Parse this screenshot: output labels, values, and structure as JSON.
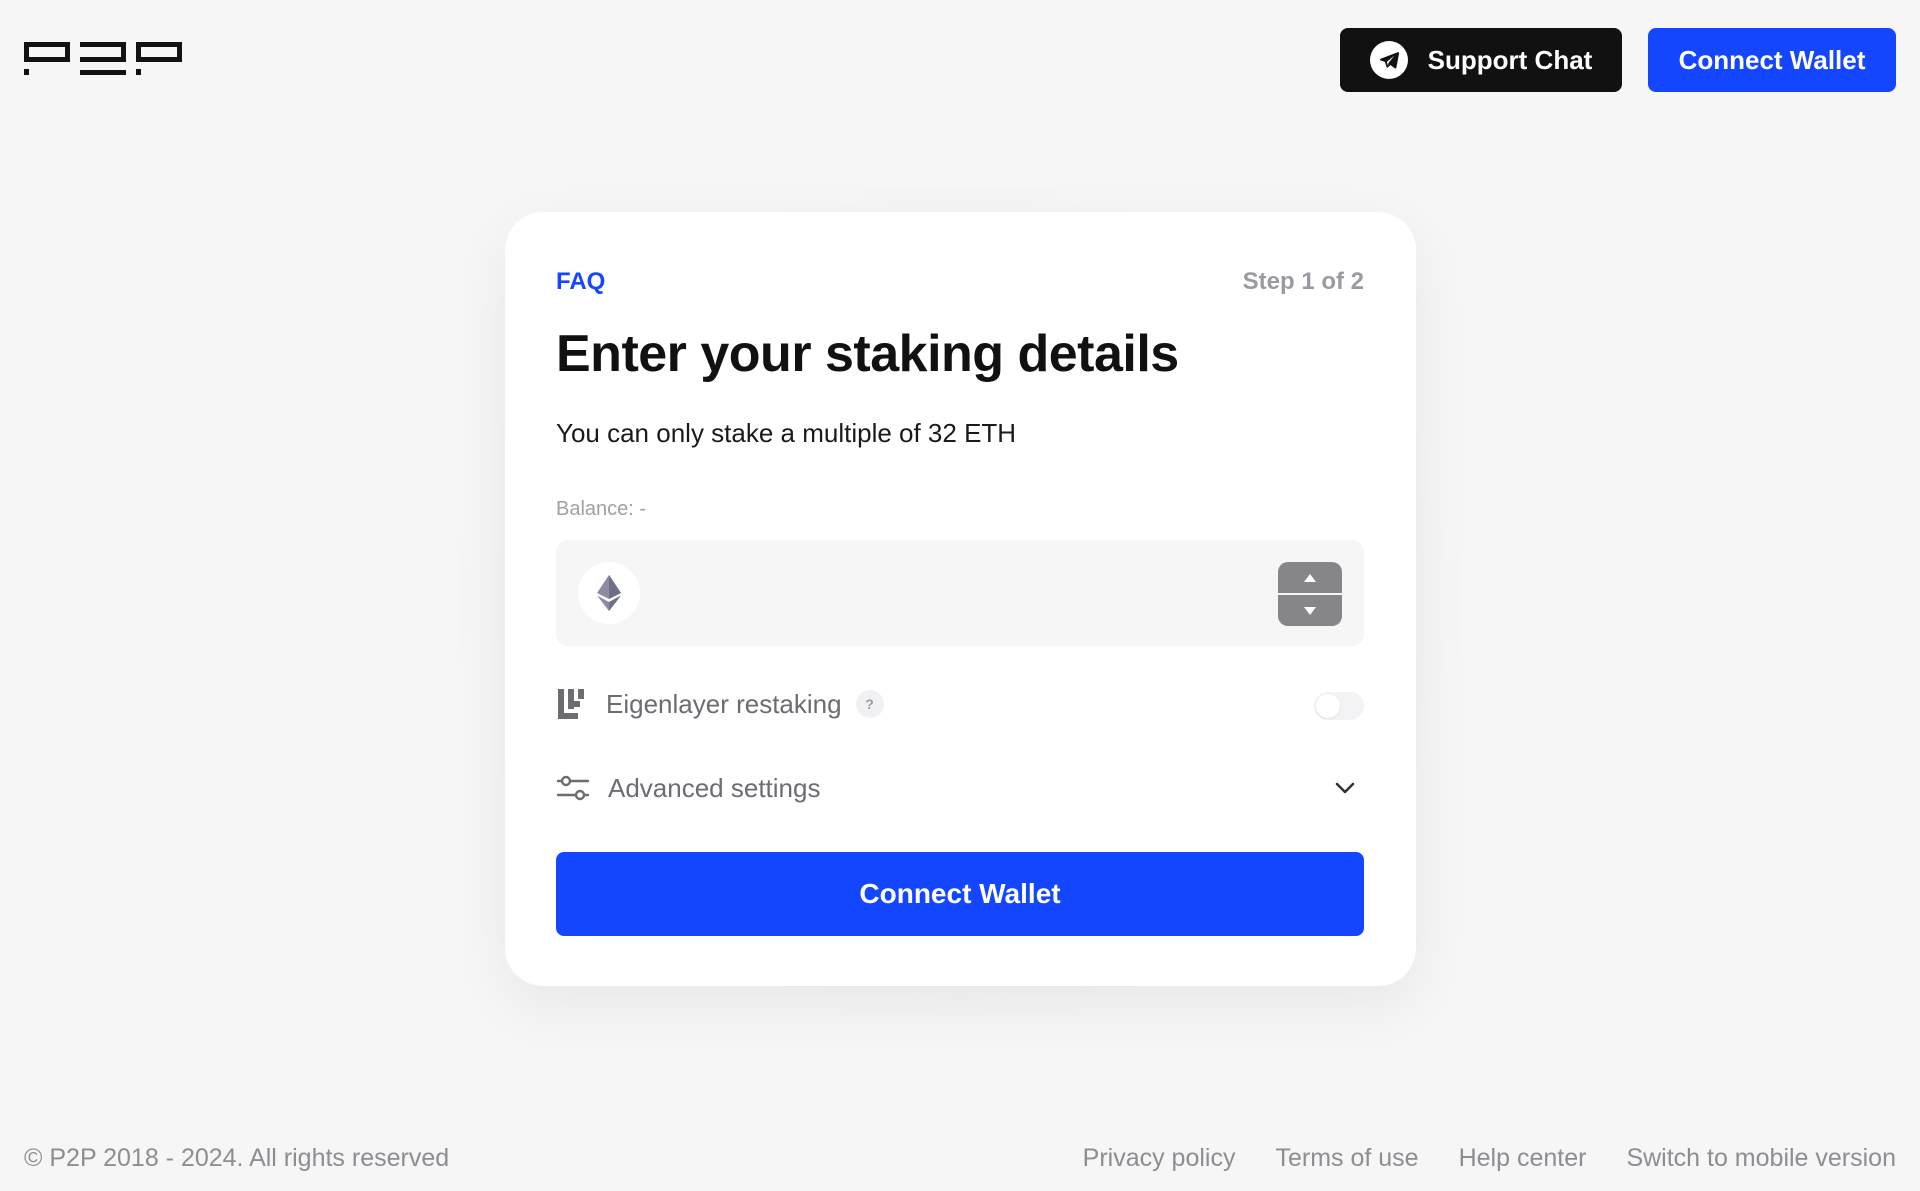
{
  "header": {
    "logo_text": "P2P",
    "support_label": "Support Chat",
    "connect_label": "Connect Wallet"
  },
  "card": {
    "faq_label": "FAQ",
    "step_text": "Step 1 of 2",
    "title": "Enter your staking details",
    "subtitle": "You can only stake a multiple of 32 ETH",
    "balance_text": "Balance: -",
    "amount": {
      "value": "",
      "placeholder": "",
      "token_icon": "ethereum-icon"
    },
    "eigenlayer": {
      "label": "Eigenlayer restaking",
      "help": "?",
      "enabled": false
    },
    "advanced": {
      "label": "Advanced settings",
      "expanded": false
    },
    "cta_label": "Connect Wallet"
  },
  "footer": {
    "copyright": "© P2P 2018 - 2024. All rights reserved",
    "links": [
      "Privacy policy",
      "Terms of use",
      "Help center",
      "Switch to mobile version"
    ]
  },
  "colors": {
    "accent": "#1446ff",
    "dark_button": "#111111",
    "background": "#f6f6f7",
    "muted_text": "#8d8d92"
  }
}
